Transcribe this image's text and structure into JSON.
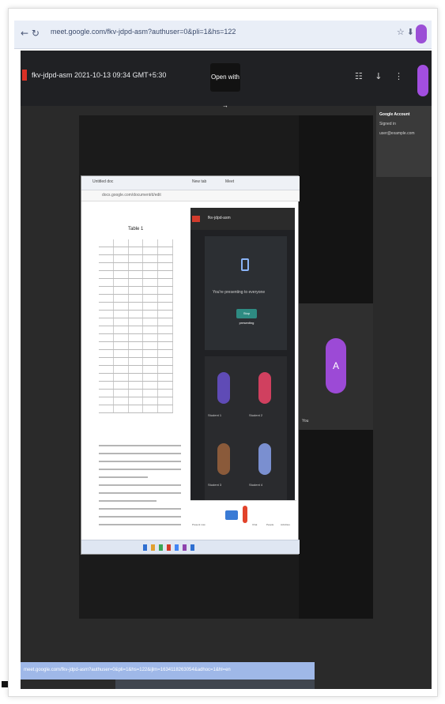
{
  "browser": {
    "nav": "← ↻",
    "url": "meet.google.com/fkv-jdpd-asm?authuser=0&pli=1&hs=122",
    "right_icons": "☆ ⬇"
  },
  "meeting": {
    "title": "fkv-jdpd-asm 2021-10-13 09:34 GMT+5:30",
    "open_button": "Open with →",
    "top_icons": "☷ ↓ ⋮",
    "account": {
      "name": "Google Account",
      "detail": "Signed in",
      "email": "user@example.com"
    },
    "stage_tile_label": "You",
    "stage_avatar_letter": "A"
  },
  "shared_screen": {
    "tabs": [
      "Untitled doc",
      "New tab",
      "Meet"
    ],
    "url": "docs.google.com/document/d/edit",
    "doc_heading": "Table 1",
    "meet_panel_title": "fkv-jdpd-asm",
    "present_text": "You're presenting to everyone",
    "present_button": "Stop presenting",
    "participants": [
      "Student 1",
      "Student 2",
      "Student 3",
      "Student 4"
    ],
    "dock_labels": [
      "Present now",
      "Chat",
      "People",
      "Activities"
    ]
  },
  "bottom_banner": "meet.google.com/fkv-jdpd-asm?authuser=0&pli=1&hs=122&ijlm=1634118263054&adhoc=1&hl=en",
  "colors": {
    "meet_background": "#2a2a2a",
    "accent_purple": "#9c4ad6",
    "record_red": "#d93025",
    "present_teal": "#2e8b82"
  }
}
